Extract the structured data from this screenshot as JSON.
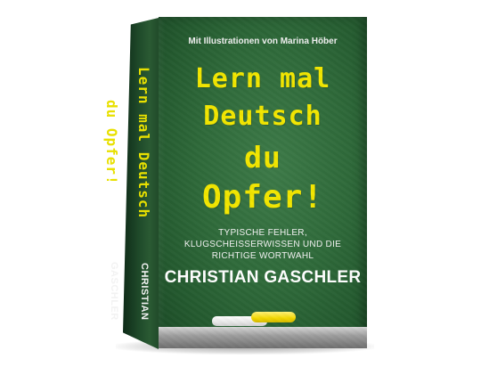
{
  "book": {
    "subtitle_top": "Mit Illustrationen von Marina Höber",
    "title_lines": [
      "Lern mal",
      "Deutsch",
      "du",
      "Opfer!"
    ],
    "tagline_lines": [
      "TYPISCHE FEHLER,",
      "KLUGSCHEISSERWISSEN UND DIE",
      "RICHTIGE WORTWAHL"
    ],
    "author": "CHRISTIAN GASCHLER",
    "spine_title": "Lern mal Deutsch du Opfer!",
    "spine_author": "CHRISTIAN GASCHLER"
  },
  "colors": {
    "chalkboard": "#2f6a3a",
    "title_yellow": "#f2e600",
    "text_white": "#ffffff",
    "tray_grey": "#9e9e9e"
  }
}
